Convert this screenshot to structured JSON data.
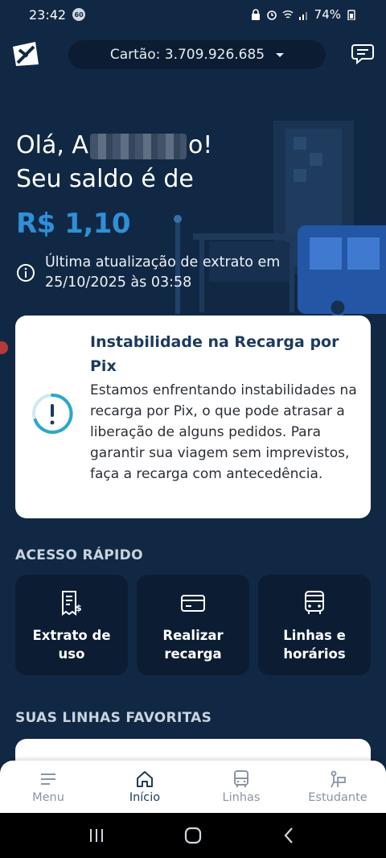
{
  "status_bar": {
    "time": "23:42",
    "badge": "60",
    "battery": "74%"
  },
  "header": {
    "card_label": "Cartão: 3.709.926.685"
  },
  "greeting": {
    "hello_prefix": "Olá, A",
    "hello_suffix": "o!",
    "line2": "Seu saldo é de"
  },
  "balance": "R$ 1,10",
  "updated": {
    "line1": "Última atualização de extrato em",
    "line2": "25/10/2025 às 03:58"
  },
  "notice": {
    "title": "Instabilidade na Recarga por Pix",
    "body": "Estamos enfrentando instabilidades na recarga por Pix, o que pode atrasar a liberação de alguns pedidos. Para garantir sua viagem sem imprevistos, faça a recarga com antecedência."
  },
  "quick_access": {
    "title": "ACESSO RÁPIDO",
    "items": [
      {
        "label": "Extrato de uso",
        "icon": "receipt-icon"
      },
      {
        "label": "Realizar recarga",
        "icon": "card-icon"
      },
      {
        "label": "Linhas e horários",
        "icon": "bus-icon"
      }
    ]
  },
  "favorites": {
    "title": "SUAS LINHAS FAVORITAS"
  },
  "bottom_nav": {
    "items": [
      {
        "label": "Menu",
        "icon": "menu-icon"
      },
      {
        "label": "Início",
        "icon": "home-icon",
        "active": true
      },
      {
        "label": "Linhas",
        "icon": "bus-icon"
      },
      {
        "label": "Estudante",
        "icon": "student-icon"
      }
    ]
  },
  "colors": {
    "background": "#112844",
    "accent": "#2f8fd8",
    "notice_icon": "#2aa7c9"
  }
}
